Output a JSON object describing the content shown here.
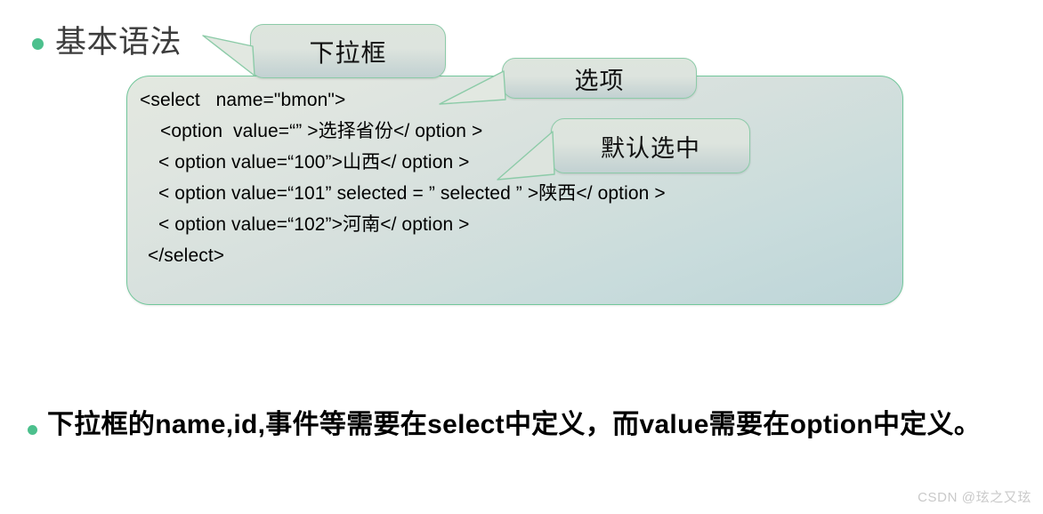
{
  "slide": {
    "background_color": "#ffffff",
    "accent_color": "#4CC08D",
    "panel_border_color": "#72C79B",
    "callout_border_color": "#8CCBA8",
    "text_color": "#000000"
  },
  "heading": {
    "bullet": "•",
    "text": "基本语法"
  },
  "code_panel": {
    "lines": [
      "<select   name=\"bmon\">",
      "<option  value=“” >选择省份</ option >",
      "< option value=“100”>山西</ option >",
      "< option value=“101” selected = ” selected ” >陕西</ option >",
      "< option value=“102”>河南</ option >",
      "</select>"
    ]
  },
  "callouts": [
    {
      "id": "dropdown",
      "label": "下拉框"
    },
    {
      "id": "option",
      "label": "选项"
    },
    {
      "id": "selected",
      "label": "默认选中"
    }
  ],
  "note": {
    "bullet": "•",
    "text": "下拉框的name,id,事件等需要在select中定义，而value需要在option中定义。"
  },
  "watermark": {
    "text": "CSDN @玹之又玹"
  }
}
